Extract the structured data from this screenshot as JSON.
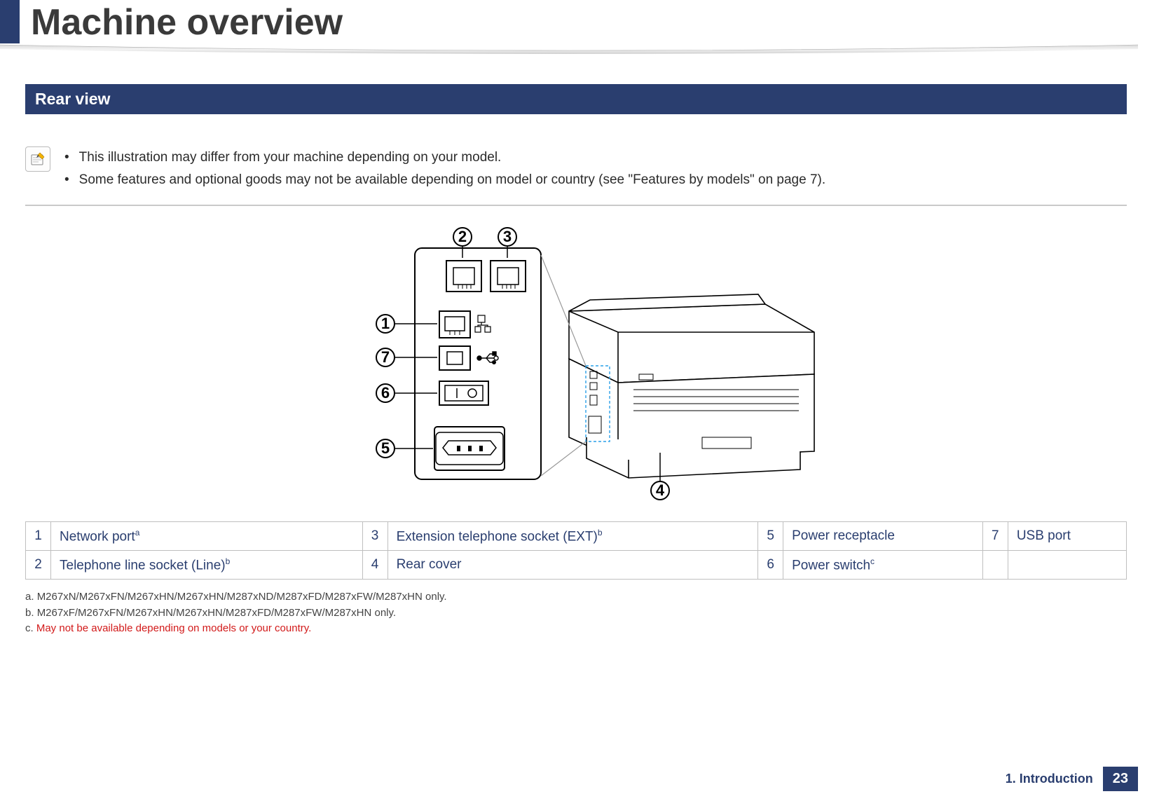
{
  "header": {
    "title": "Machine overview"
  },
  "section": {
    "title": "Rear view"
  },
  "notes": {
    "line1": "This illustration may differ from your machine depending on your model.",
    "line2": "Some features and optional goods may not be available depending on model or country (see \"Features by models\" on page 7)."
  },
  "callouts": {
    "c1": "1",
    "c2": "2",
    "c3": "3",
    "c4": "4",
    "c5": "5",
    "c6": "6",
    "c7": "7"
  },
  "parts": {
    "row1": {
      "n1": "1",
      "l1": "Network port",
      "s1": "a",
      "n3": "3",
      "l3": "Extension telephone socket (EXT)",
      "s3": "b",
      "n5": "5",
      "l5": "Power receptacle",
      "n7": "7",
      "l7": "USB port"
    },
    "row2": {
      "n2": "2",
      "l2": "Telephone line socket (Line)",
      "s2": "b",
      "n4": "4",
      "l4": "Rear cover",
      "n6": "6",
      "l6": "Power switch",
      "s6": "c"
    }
  },
  "footnotes": {
    "a_prefix": "a.",
    "a": "M267xN/M267xFN/M267xHN/M267xHN/M287xND/M287xFD/M287xFW/M287xHN only.",
    "b_prefix": "b.",
    "b": "M267xF/M267xFN/M267xHN/M267xHN/M287xFD/M287xFW/M287xHN only.",
    "c_prefix": "c.",
    "c": "May not be available depending on models or your country."
  },
  "footer": {
    "chapter": "1.  Introduction",
    "page": "23"
  }
}
